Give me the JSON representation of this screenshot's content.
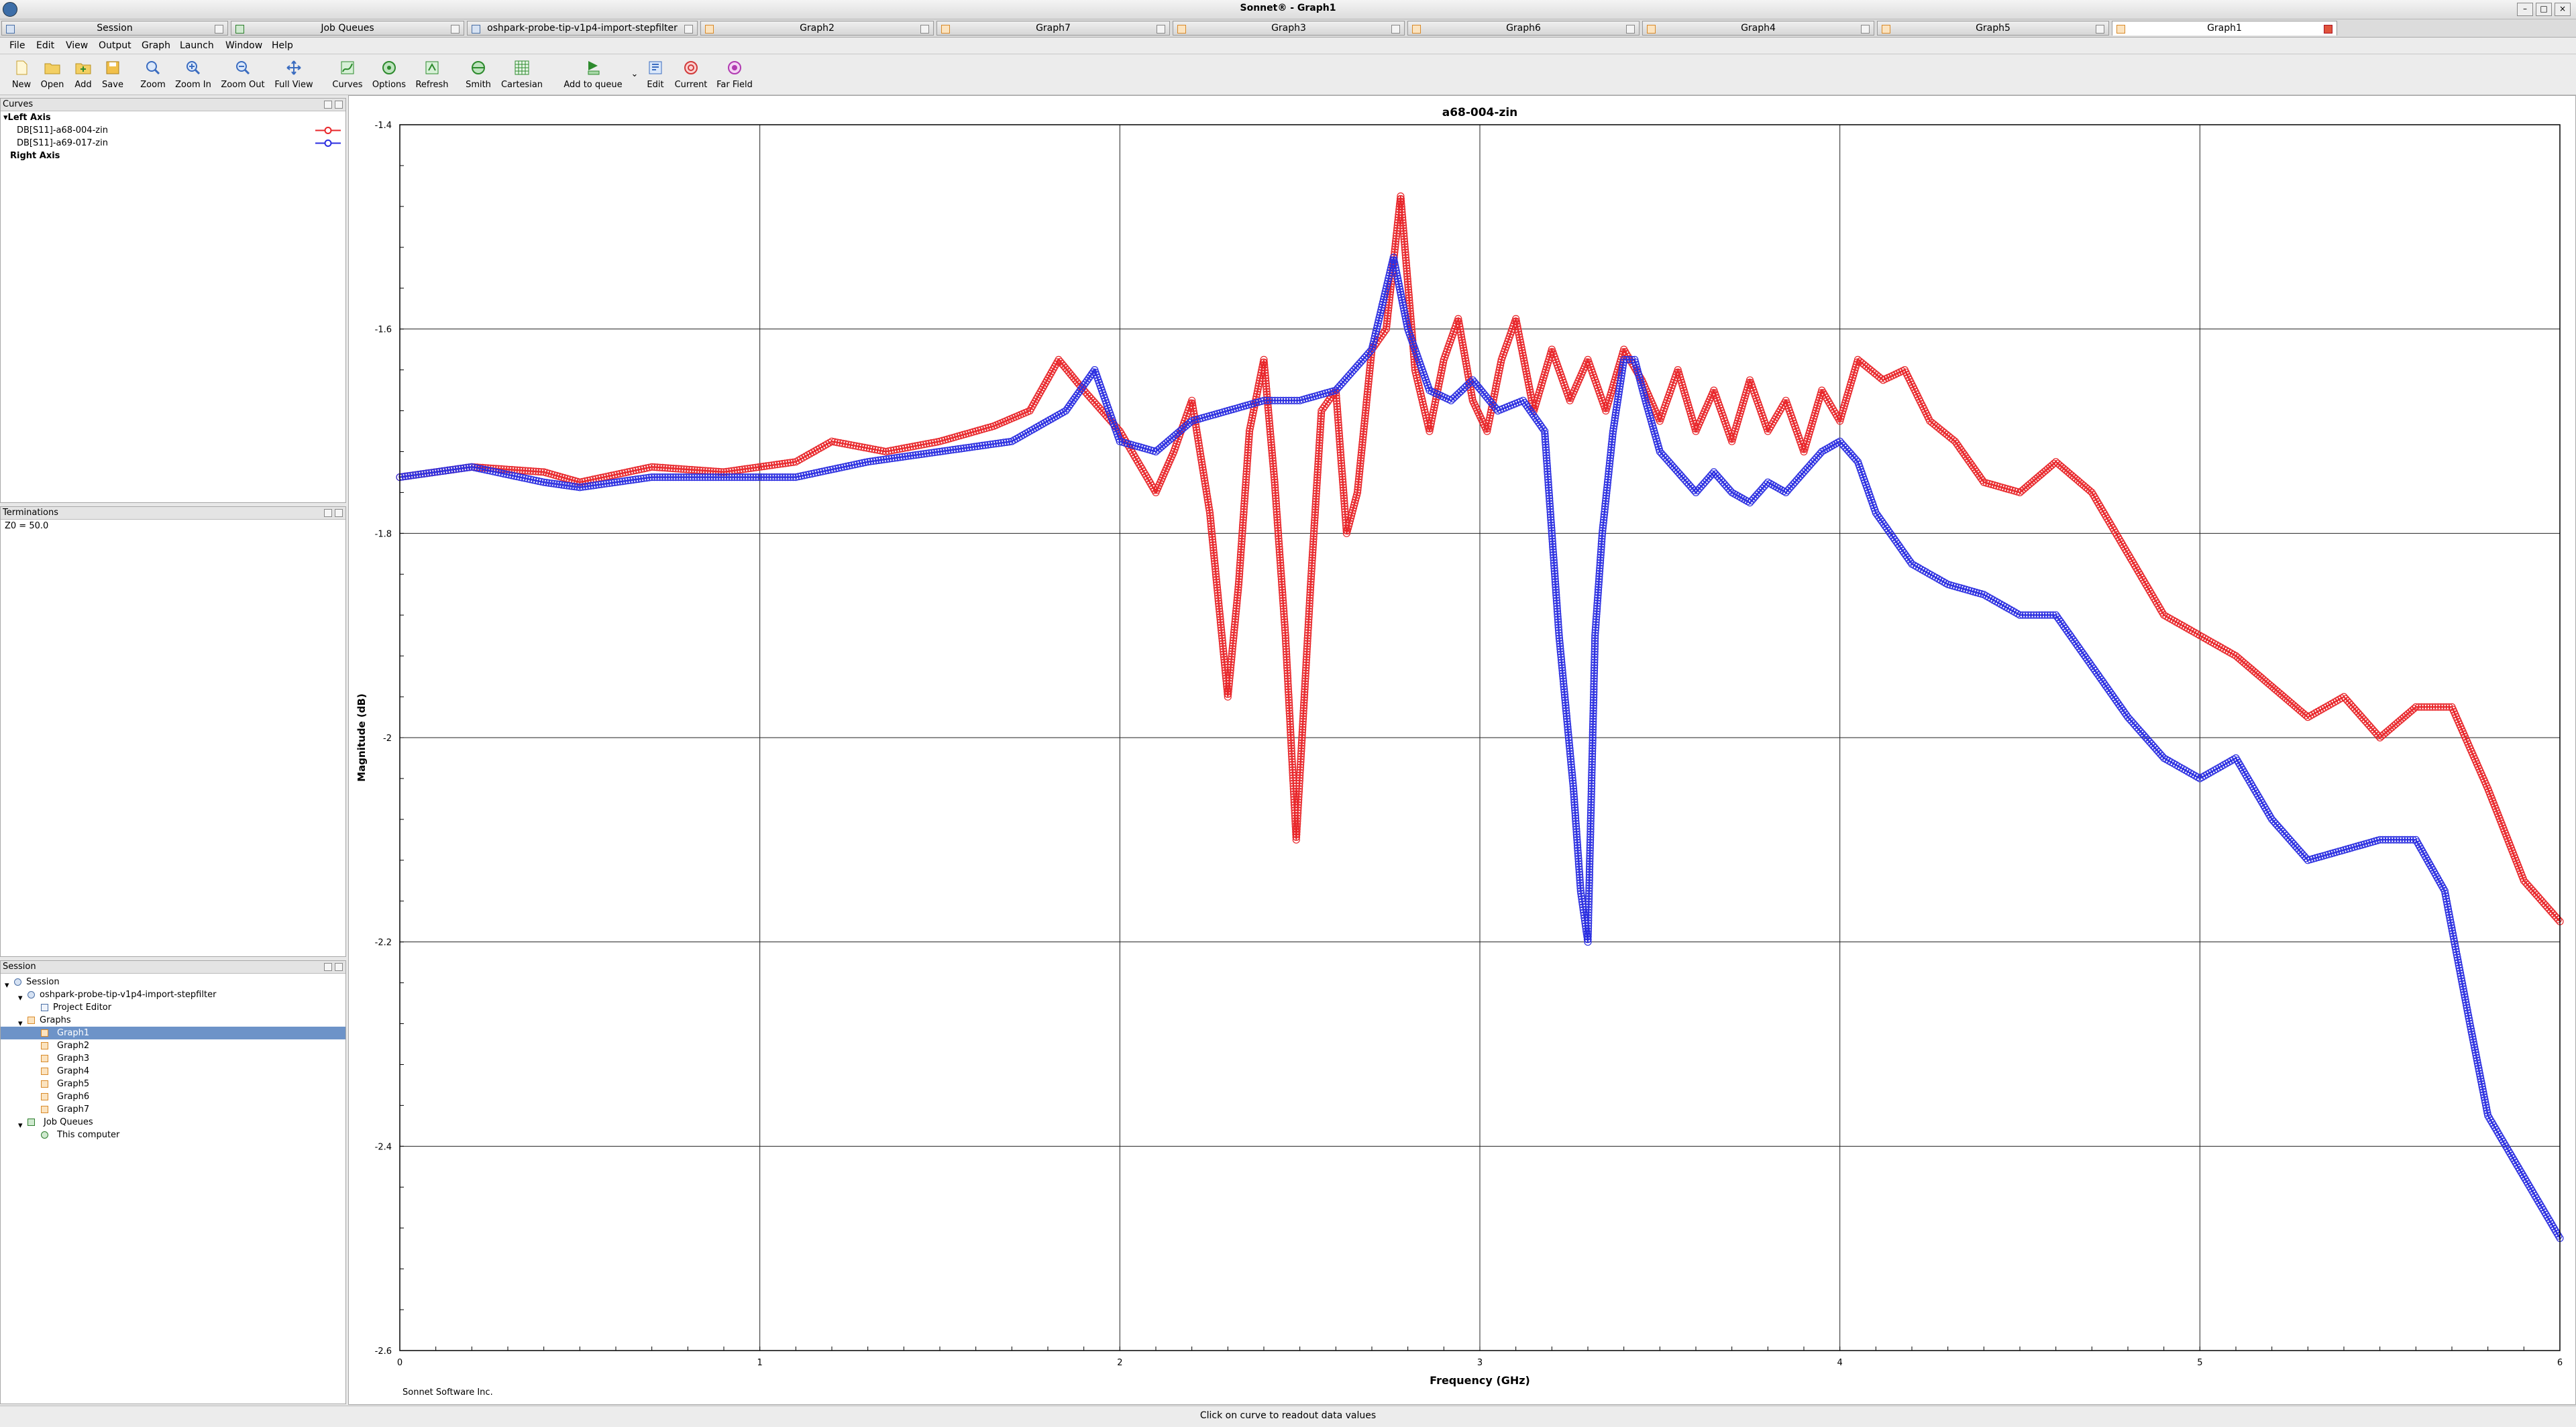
{
  "window": {
    "title": "Sonnet® - Graph1"
  },
  "tabs": [
    {
      "label": "Session"
    },
    {
      "label": "Job Queues"
    },
    {
      "label": "oshpark-probe-tip-v1p4-import-stepfilter"
    },
    {
      "label": "Graph2"
    },
    {
      "label": "Graph7"
    },
    {
      "label": "Graph3"
    },
    {
      "label": "Graph6"
    },
    {
      "label": "Graph4"
    },
    {
      "label": "Graph5"
    },
    {
      "label": "Graph1"
    }
  ],
  "menu": [
    "File",
    "Edit",
    "View",
    "Output",
    "Graph",
    "Launch",
    "Window",
    "Help"
  ],
  "toolbar": [
    {
      "label": "New",
      "icon": "new-icon"
    },
    {
      "label": "Open",
      "icon": "open-icon"
    },
    {
      "label": "Add",
      "icon": "add-icon"
    },
    {
      "label": "Save",
      "icon": "save-icon"
    },
    {
      "label": "Zoom",
      "icon": "zoom-icon"
    },
    {
      "label": "Zoom In",
      "icon": "zoom-in-icon"
    },
    {
      "label": "Zoom Out",
      "icon": "zoom-out-icon"
    },
    {
      "label": "Full View",
      "icon": "full-view-icon"
    },
    {
      "label": "Curves",
      "icon": "curves-icon"
    },
    {
      "label": "Options",
      "icon": "options-icon"
    },
    {
      "label": "Refresh",
      "icon": "refresh-icon"
    },
    {
      "label": "Smith",
      "icon": "smith-icon"
    },
    {
      "label": "Cartesian",
      "icon": "cartesian-icon"
    },
    {
      "label": "Add to queue",
      "icon": "add-to-queue-icon"
    },
    {
      "label": "Edit",
      "icon": "edit-icon"
    },
    {
      "label": "Current",
      "icon": "current-icon"
    },
    {
      "label": "Far Field",
      "icon": "far-field-icon"
    }
  ],
  "curves_panel": {
    "title": "Curves",
    "left_axis": "Left Axis",
    "right_axis": "Right Axis",
    "curves": [
      {
        "label": "DB[S11]-a68-004-zin",
        "color": "#e8262a"
      },
      {
        "label": "DB[S11]-a69-017-zin",
        "color": "#2b2ee0"
      }
    ]
  },
  "terminations_panel": {
    "title": "Terminations",
    "text": "Z0 = 50.0"
  },
  "session_panel": {
    "title": "Session",
    "tree": [
      {
        "label": "Session",
        "level": 0,
        "icon": "session-icon"
      },
      {
        "label": "oshpark-probe-tip-v1p4-import-stepfilter",
        "level": 1,
        "icon": "project-icon"
      },
      {
        "label": "Project Editor",
        "level": 2,
        "icon": "editor-icon"
      },
      {
        "label": "Graphs",
        "level": 1,
        "icon": "folder-icon"
      },
      {
        "label": "Graph1",
        "level": 2,
        "icon": "graph-icon",
        "selected": true
      },
      {
        "label": "Graph2",
        "level": 2,
        "icon": "graph-icon"
      },
      {
        "label": "Graph3",
        "level": 2,
        "icon": "graph-icon"
      },
      {
        "label": "Graph4",
        "level": 2,
        "icon": "graph-icon"
      },
      {
        "label": "Graph5",
        "level": 2,
        "icon": "graph-icon"
      },
      {
        "label": "Graph6",
        "level": 2,
        "icon": "graph-icon"
      },
      {
        "label": "Graph7",
        "level": 2,
        "icon": "graph-icon"
      },
      {
        "label": "Job Queues",
        "level": 1,
        "icon": "queue-icon"
      },
      {
        "label": "This computer",
        "level": 2,
        "icon": "computer-icon"
      }
    ]
  },
  "footer": {
    "company": "Sonnet Software Inc."
  },
  "status": {
    "text": "Click on curve to readout data values"
  },
  "chart_data": {
    "type": "line",
    "title": "a68-004-zin",
    "xlabel": "Frequency (GHz)",
    "ylabel": "Magnitude (dB)",
    "xlim": [
      0,
      6
    ],
    "ylim": [
      -2.6,
      -1.4
    ],
    "xticks": [
      0,
      1,
      2,
      3,
      4,
      5,
      6
    ],
    "yticks": [
      -1.4,
      -1.6,
      -1.8,
      -2,
      -2.2,
      -2.4,
      -2.6
    ],
    "grid": true,
    "series": [
      {
        "name": "DB[S11]-a68-004-zin",
        "color": "#e8262a",
        "x": [
          0,
          0.2,
          0.4,
          0.5,
          0.7,
          0.9,
          1.1,
          1.2,
          1.35,
          1.5,
          1.65,
          1.75,
          1.83,
          1.9,
          2.0,
          2.1,
          2.15,
          2.2,
          2.25,
          2.3,
          2.33,
          2.36,
          2.4,
          2.43,
          2.46,
          2.49,
          2.53,
          2.56,
          2.6,
          2.63,
          2.66,
          2.7,
          2.74,
          2.78,
          2.82,
          2.86,
          2.9,
          2.94,
          2.98,
          3.02,
          3.06,
          3.1,
          3.15,
          3.2,
          3.25,
          3.3,
          3.35,
          3.4,
          3.45,
          3.5,
          3.55,
          3.6,
          3.65,
          3.7,
          3.75,
          3.8,
          3.85,
          3.9,
          3.95,
          4.0,
          4.05,
          4.12,
          4.18,
          4.25,
          4.32,
          4.4,
          4.5,
          4.6,
          4.7,
          4.8,
          4.9,
          5.0,
          5.1,
          5.2,
          5.3,
          5.4,
          5.5,
          5.6,
          5.7,
          5.8,
          5.9,
          6.0
        ],
        "y": [
          -1.745,
          -1.735,
          -1.74,
          -1.75,
          -1.735,
          -1.74,
          -1.73,
          -1.71,
          -1.72,
          -1.71,
          -1.695,
          -1.68,
          -1.63,
          -1.66,
          -1.7,
          -1.76,
          -1.72,
          -1.67,
          -1.78,
          -1.96,
          -1.85,
          -1.7,
          -1.63,
          -1.75,
          -1.9,
          -2.1,
          -1.85,
          -1.68,
          -1.66,
          -1.8,
          -1.76,
          -1.62,
          -1.6,
          -1.47,
          -1.64,
          -1.7,
          -1.63,
          -1.59,
          -1.67,
          -1.7,
          -1.63,
          -1.59,
          -1.68,
          -1.62,
          -1.67,
          -1.63,
          -1.68,
          -1.62,
          -1.65,
          -1.69,
          -1.64,
          -1.7,
          -1.66,
          -1.71,
          -1.65,
          -1.7,
          -1.67,
          -1.72,
          -1.66,
          -1.69,
          -1.63,
          -1.65,
          -1.64,
          -1.69,
          -1.71,
          -1.75,
          -1.76,
          -1.73,
          -1.76,
          -1.82,
          -1.88,
          -1.9,
          -1.92,
          -1.95,
          -1.98,
          -1.96,
          -2.0,
          -1.97,
          -1.97,
          -2.05,
          -2.14,
          -2.18
        ]
      },
      {
        "name": "DB[S11]-a69-017-zin",
        "color": "#2b2ee0",
        "x": [
          0,
          0.2,
          0.4,
          0.5,
          0.7,
          0.9,
          1.1,
          1.3,
          1.5,
          1.7,
          1.85,
          1.93,
          2.0,
          2.1,
          2.2,
          2.3,
          2.4,
          2.5,
          2.6,
          2.7,
          2.76,
          2.8,
          2.86,
          2.92,
          2.98,
          3.05,
          3.12,
          3.18,
          3.22,
          3.26,
          3.28,
          3.3,
          3.32,
          3.34,
          3.37,
          3.4,
          3.43,
          3.46,
          3.5,
          3.55,
          3.6,
          3.65,
          3.7,
          3.75,
          3.8,
          3.85,
          3.9,
          3.95,
          4.0,
          4.05,
          4.1,
          4.2,
          4.3,
          4.4,
          4.5,
          4.6,
          4.7,
          4.8,
          4.9,
          5.0,
          5.1,
          5.2,
          5.3,
          5.4,
          5.5,
          5.6,
          5.68,
          5.75,
          5.8,
          5.9,
          6.0
        ],
        "y": [
          -1.745,
          -1.735,
          -1.75,
          -1.755,
          -1.745,
          -1.745,
          -1.745,
          -1.73,
          -1.72,
          -1.71,
          -1.68,
          -1.64,
          -1.71,
          -1.72,
          -1.69,
          -1.68,
          -1.67,
          -1.67,
          -1.66,
          -1.62,
          -1.53,
          -1.6,
          -1.66,
          -1.67,
          -1.65,
          -1.68,
          -1.67,
          -1.7,
          -1.9,
          -2.05,
          -2.15,
          -2.2,
          -1.9,
          -1.8,
          -1.7,
          -1.63,
          -1.63,
          -1.67,
          -1.72,
          -1.74,
          -1.76,
          -1.74,
          -1.76,
          -1.77,
          -1.75,
          -1.76,
          -1.74,
          -1.72,
          -1.71,
          -1.73,
          -1.78,
          -1.83,
          -1.85,
          -1.86,
          -1.88,
          -1.88,
          -1.93,
          -1.98,
          -2.02,
          -2.04,
          -2.02,
          -2.08,
          -2.12,
          -2.11,
          -2.1,
          -2.1,
          -2.15,
          -2.28,
          -2.37,
          -2.43,
          -2.49
        ]
      }
    ]
  }
}
